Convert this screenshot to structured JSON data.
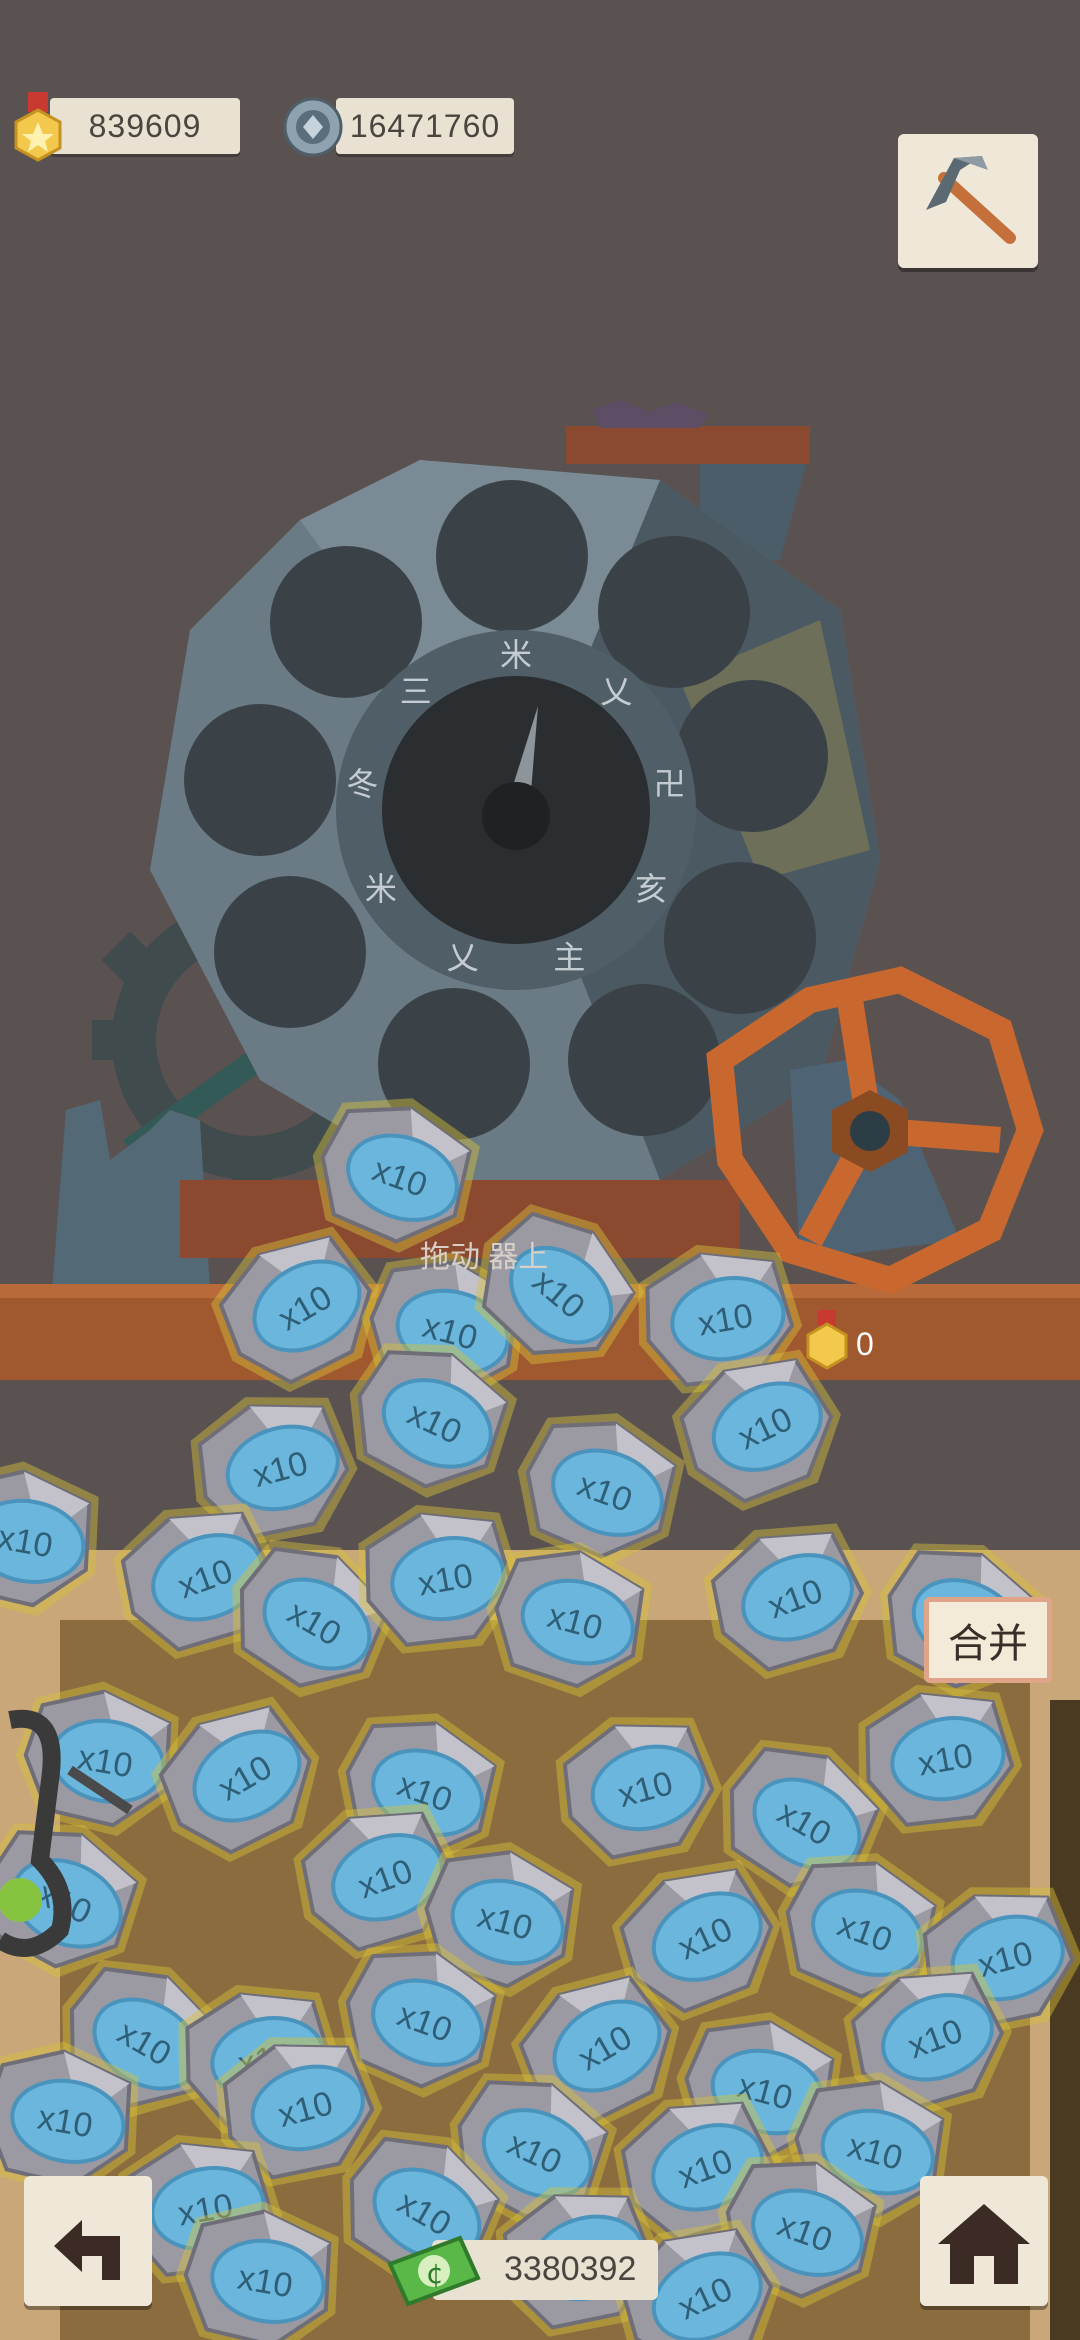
{
  "resources": {
    "medals": "839609",
    "gears": "16471760",
    "cash": "3380392"
  },
  "machine": {
    "dial_glyphs": [
      "米",
      "乂",
      "卍",
      "亥",
      "主",
      "乂",
      "米",
      "冬",
      "三"
    ],
    "hint": "拖动 器上",
    "reward_count": "0"
  },
  "buttons": {
    "merge": "合并",
    "pickaxe": "pickaxe-icon",
    "back": "back-arrow-icon",
    "home": "house-icon"
  },
  "ore_label": "x10",
  "colors": {
    "background": "#5a5251",
    "paper": "#e9e2d2",
    "ore_gem": "#6bb6dc",
    "wheel": "#c8682e",
    "gold": "#f2c94c"
  }
}
